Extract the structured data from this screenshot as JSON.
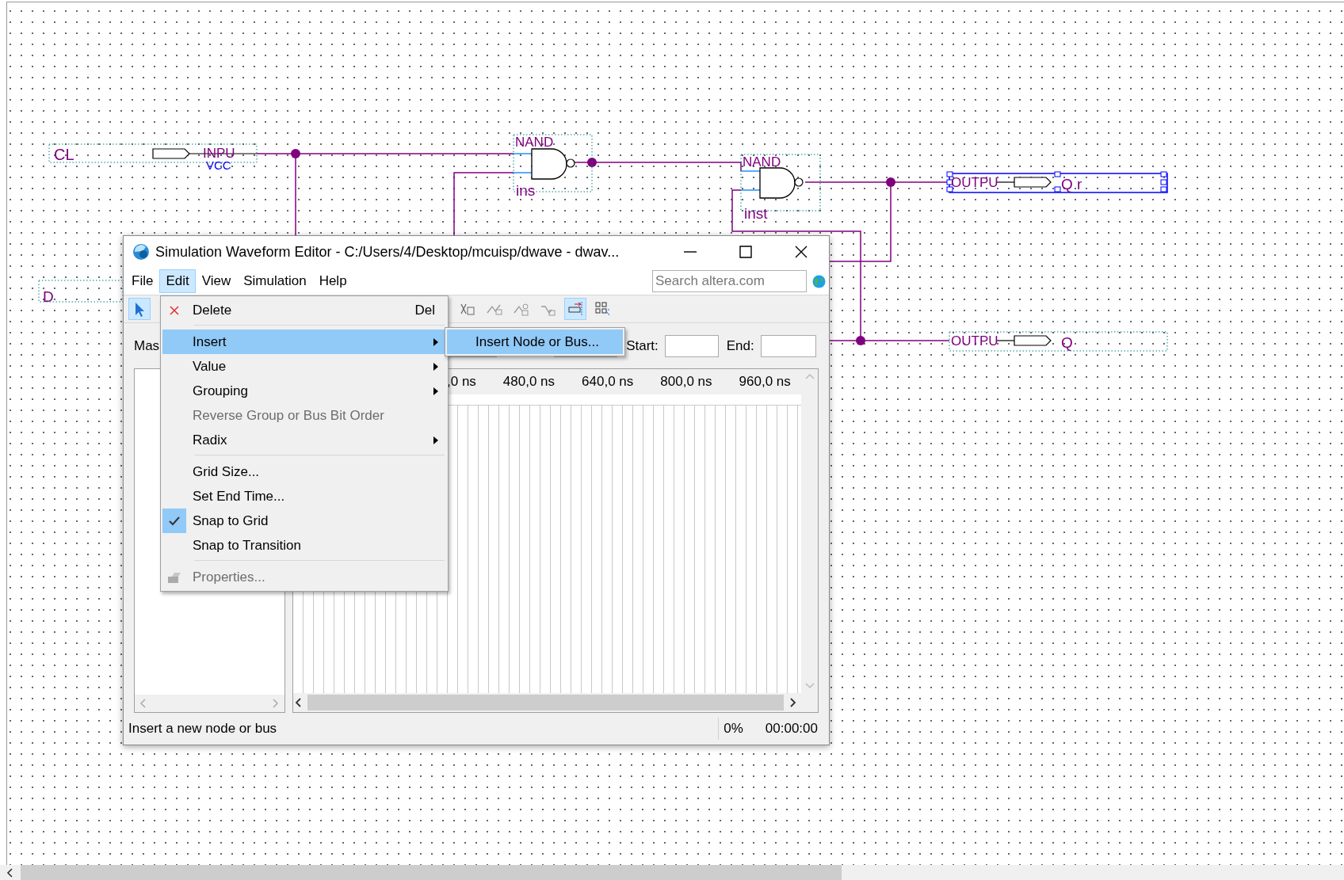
{
  "schematic": {
    "input_pins": [
      {
        "name": "CL",
        "type_label": "INPU",
        "net_label": "VCC"
      },
      {
        "name": "D"
      }
    ],
    "gates": [
      {
        "type_label": "NAND",
        "instance": "ins"
      },
      {
        "type_label": "NAND",
        "instance": "inst"
      }
    ],
    "output_pins": [
      {
        "type_label": "OUTPU",
        "name": "Q r",
        "selected": true
      },
      {
        "type_label": "OUTPU",
        "name": "Q",
        "selected": false
      }
    ]
  },
  "window": {
    "title": "Simulation Waveform Editor - C:/Users/4/Desktop/mcuisp/dwave - dwav...",
    "menu_bar": [
      {
        "label": "File",
        "selected": false
      },
      {
        "label": "Edit",
        "selected": true
      },
      {
        "label": "View",
        "selected": false
      },
      {
        "label": "Simulation",
        "selected": false
      },
      {
        "label": "Help",
        "selected": false
      }
    ],
    "search": {
      "placeholder": "Search altera.com"
    },
    "toolbar": [
      {
        "kind": "pointer",
        "on": true
      },
      {
        "kind": "invert",
        "on": false
      },
      {
        "kind": "count",
        "on": false
      },
      {
        "kind": "clock",
        "on": false
      },
      {
        "kind": "random",
        "on": false
      },
      {
        "kind": "snap",
        "on": true
      },
      {
        "kind": "grid",
        "on": false
      }
    ],
    "master_row": {
      "label": "Mas",
      "start_label": "Start:",
      "end_label": "End:"
    },
    "ruler": [
      ",0 ns",
      "480,0 ns",
      "640,0 ns",
      "800,0 ns",
      "960,0 ns"
    ],
    "status_bar": {
      "message": "Insert a new node or bus",
      "progress": "0%",
      "elapsed": "00:00:00"
    }
  },
  "edit_menu": [
    {
      "kind": "delete",
      "label": "Delete",
      "shortcut": "Del",
      "selected": false,
      "disabled": false
    },
    {
      "kind": "separator"
    },
    {
      "kind": "submenu",
      "label": "Insert",
      "selected": true,
      "disabled": false
    },
    {
      "kind": "submenu",
      "label": "Value",
      "selected": false,
      "disabled": false
    },
    {
      "kind": "submenu",
      "label": "Grouping",
      "selected": false,
      "disabled": false
    },
    {
      "kind": "command",
      "label": "Reverse Group or Bus Bit Order",
      "selected": false,
      "disabled": true
    },
    {
      "kind": "submenu",
      "label": "Radix",
      "selected": false,
      "disabled": false
    },
    {
      "kind": "separator"
    },
    {
      "kind": "command",
      "label": "Grid Size...",
      "selected": false,
      "disabled": false
    },
    {
      "kind": "command",
      "label": "Set End Time...",
      "selected": false,
      "disabled": false
    },
    {
      "kind": "check",
      "label": "Snap to Grid",
      "checked": true,
      "selected": false,
      "disabled": false
    },
    {
      "kind": "check",
      "label": "Snap to Transition",
      "checked": false,
      "selected": false,
      "disabled": false
    },
    {
      "kind": "separator"
    },
    {
      "kind": "properties",
      "label": "Properties...",
      "selected": false,
      "disabled": true
    }
  ],
  "insert_submenu": [
    {
      "label": "Insert Node or Bus...",
      "selected": true
    }
  ]
}
